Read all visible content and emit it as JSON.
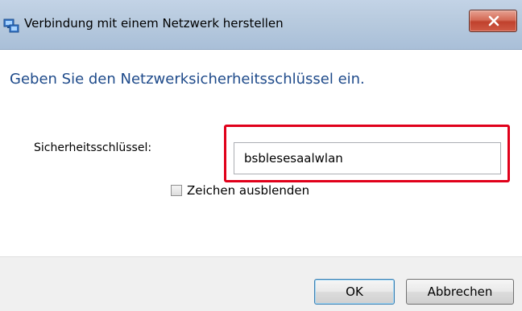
{
  "window": {
    "title": "Verbindung mit einem Netzwerk herstellen",
    "title_icon": "network-icon",
    "close_icon": "close-icon"
  },
  "main": {
    "heading": "Geben Sie den Netzwerksicherheitsschlüssel ein.",
    "key_label": "Sicherheitsschlüssel:",
    "key_value": "bsblesesaalwlan",
    "hide_chars_label": "Zeichen ausblenden",
    "hide_chars_checked": false
  },
  "footer": {
    "ok_label": "OK",
    "cancel_label": "Abbrechen"
  },
  "colors": {
    "heading": "#1e4a8a",
    "highlight": "#e0001a",
    "close_button": "#c0422d"
  }
}
